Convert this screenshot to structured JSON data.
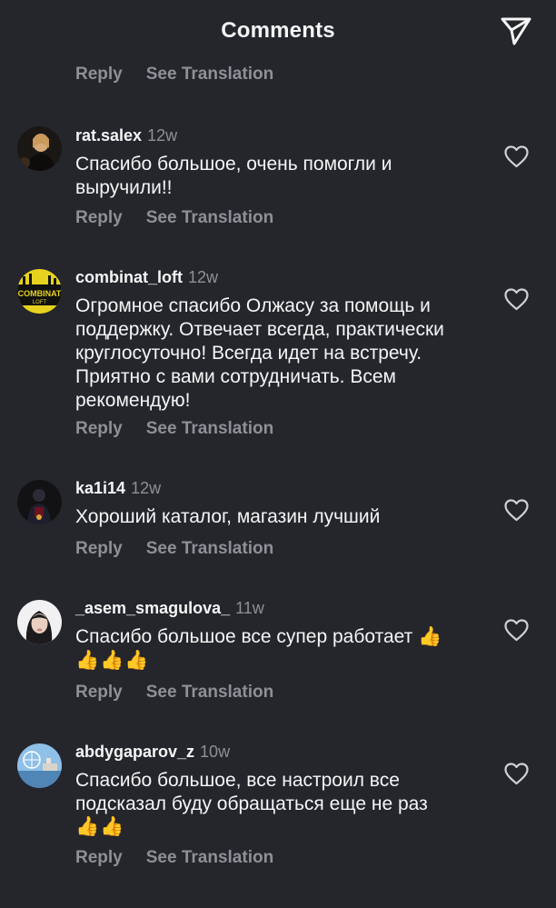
{
  "header": {
    "title": "Comments"
  },
  "top_actions": {
    "reply": "Reply",
    "see_translation": "See Translation"
  },
  "comments": [
    {
      "username": "rat.salex",
      "time": "12w",
      "text": "Спасибо большое, очень помогли и выручили!!",
      "reply": "Reply",
      "see_translation": "See Translation"
    },
    {
      "username": "combinat_loft",
      "time": "12w",
      "avatar_text_1": "COMBINAT",
      "avatar_text_2": "LOFT",
      "text": "Огромное спасибо Олжасу за помощь и поддержку. Отвечает всегда, практически круглосуточно! Всегда идет на встречу. Приятно с вами сотрудничать. Всем рекомендую!",
      "reply": "Reply",
      "see_translation": "See Translation"
    },
    {
      "username": "ka1i14",
      "time": "12w",
      "text": "Хороший каталог, магазин лучший",
      "reply": "Reply",
      "see_translation": "See Translation"
    },
    {
      "username": "_asem_smagulova_",
      "time": "11w",
      "text": "Спасибо большое все супер работает 👍",
      "emoji_line": "👍👍👍",
      "reply": "Reply",
      "see_translation": "See Translation"
    },
    {
      "username": "abdygaparov_z",
      "time": "10w",
      "text": "Спасибо большое, все настроил все подсказал буду обращаться еще не раз",
      "emoji_line": "👍👍",
      "reply": "Reply",
      "see_translation": "See Translation"
    }
  ],
  "colors": {
    "background": "#24262c",
    "primary_text": "#f5f5f5",
    "secondary_text": "#8e9096"
  },
  "icons": {
    "share": "send-icon",
    "like": "heart-icon"
  }
}
